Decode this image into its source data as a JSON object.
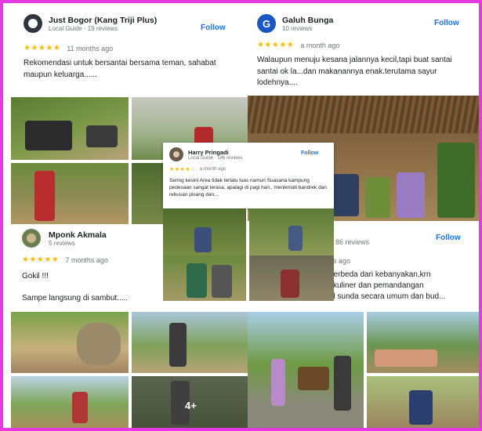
{
  "reviews": [
    {
      "name": "Just Bogor (Kang Triji Plus)",
      "meta": "Local Guide · 19 reviews",
      "follow": "Follow",
      "stars": "★★★★★",
      "time": "11 months ago",
      "text": "Rekomendasi untuk bersantai bersama teman, sahabat maupun keluarga......",
      "avatar_color": "#2f3640"
    },
    {
      "name": "Galuh Bunga",
      "meta": "10 reviews",
      "follow": "Follow",
      "avatar_letter": "G",
      "stars": "★★★★★",
      "time": "a month ago",
      "text": "Walaupun menuju kesana jalannya kecil,tapi buat santai santai ok la...dan makanannya enak.terutama sayur lodehnya....",
      "avatar_color": "#1a56c4"
    },
    {
      "name": "Harry Pringadi",
      "meta": "Local Guide · 146 reviews",
      "follow": "Follow",
      "stars": "★★★★☆",
      "time": "a month ago",
      "text": "Sering kesini Area tidak terlalu luas namun Suasana kampung pedesaan sangat terasa, apalagi di pagi hari.. menikmati bandrek dan rebusan pisang dan...",
      "avatar_color": "#6b5a4c"
    },
    {
      "name": "Mponk Akmala",
      "meta": "5 reviews",
      "stars": "★★★★★",
      "time": "7 months ago",
      "text1": "Gokil !!!",
      "text2": "Sampe langsung di sambut.....",
      "avatar_color": "#6d7d52"
    },
    {
      "meta_partial": "86 reviews",
      "follow": "Follow",
      "time_partial": "hs ago",
      "text_lines": [
        "berbeda dari kebanyakan,krn",
        "l kuliner dan pemandangan",
        "al sunda secara umum dan bud..."
      ]
    }
  ],
  "photo_more": "4+",
  "colors": {
    "frame": "#e33be0",
    "link": "#1a73e8",
    "star": "#fbbc04"
  }
}
